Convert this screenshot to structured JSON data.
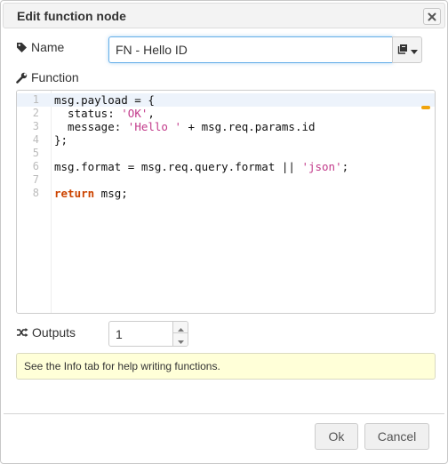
{
  "dialog": {
    "title": "Edit function node",
    "close_icon": "close-icon"
  },
  "name_field": {
    "label": "Name",
    "value": "FN - Hello ID",
    "icon": "tag-icon",
    "library_icon": "book-icon"
  },
  "function_field": {
    "label": "Function",
    "icon": "wrench-icon",
    "code_lines": [
      {
        "num": "1",
        "parts": [
          [
            "plain",
            "msg.payload = {"
          ]
        ]
      },
      {
        "num": "2",
        "parts": [
          [
            "plain",
            "  status: "
          ],
          [
            "str",
            "'OK'"
          ],
          [
            "plain",
            ","
          ]
        ]
      },
      {
        "num": "3",
        "parts": [
          [
            "plain",
            "  message: "
          ],
          [
            "str",
            "'Hello '"
          ],
          [
            "plain",
            " + msg.req.params.id"
          ]
        ]
      },
      {
        "num": "4",
        "parts": [
          [
            "plain",
            "};"
          ]
        ]
      },
      {
        "num": "5",
        "parts": [
          [
            "plain",
            ""
          ]
        ]
      },
      {
        "num": "6",
        "parts": [
          [
            "plain",
            "msg.format = msg.req.query.format || "
          ],
          [
            "str",
            "'json'"
          ],
          [
            "plain",
            ";"
          ]
        ]
      },
      {
        "num": "7",
        "parts": [
          [
            "plain",
            ""
          ]
        ]
      },
      {
        "num": "8",
        "parts": [
          [
            "kw",
            "return"
          ],
          [
            "plain",
            " msg;"
          ]
        ]
      }
    ]
  },
  "outputs_field": {
    "label": "Outputs",
    "value": "1",
    "icon": "shuffle-icon"
  },
  "tip": {
    "text": "See the Info tab for help writing functions."
  },
  "buttons": {
    "ok": "Ok",
    "cancel": "Cancel"
  },
  "colors": {
    "string": "#c23a8a",
    "keyword": "#cc4400",
    "tip_background": "#ffffd8",
    "focus_border": "#66afe9"
  }
}
